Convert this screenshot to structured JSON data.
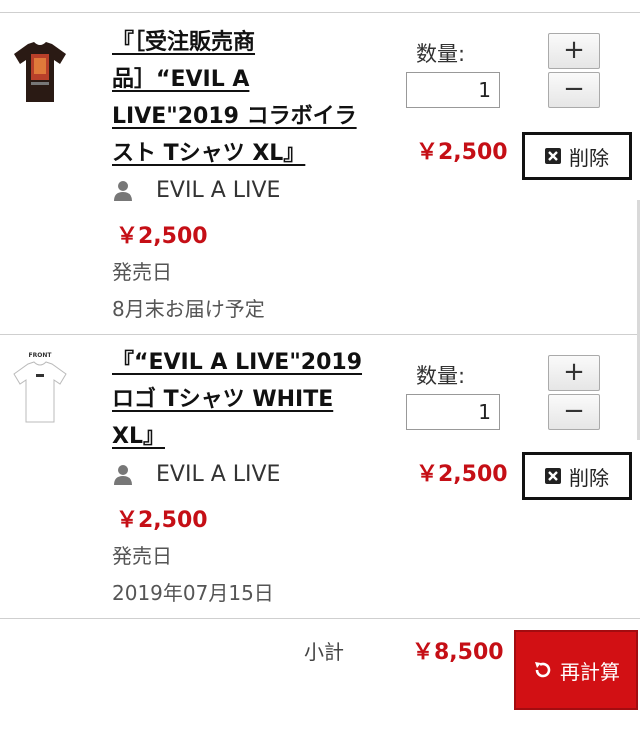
{
  "cart": {
    "items": [
      {
        "title": "『［受注販売商品］“EVIL A LIVE\"2019 コラボイラスト Tシャツ XL』",
        "artist": "EVIL A LIVE",
        "price": "￥2,500",
        "release_label": "発売日",
        "release_value": "8月末お届け予定",
        "qty_label": "数量:",
        "qty_value": "1",
        "line_total": "￥2,500",
        "plus_label": "+",
        "minus_label": "−",
        "delete_label": "削除"
      },
      {
        "title": "『“EVIL A LIVE\"2019 ロゴ Tシャツ WHITE XL』",
        "artist": "EVIL A LIVE",
        "price": "￥2,500",
        "release_label": "発売日",
        "release_value": "2019年07月15日",
        "qty_label": "数量:",
        "qty_value": "1",
        "line_total": "￥2,500",
        "plus_label": "+",
        "minus_label": "−",
        "delete_label": "削除",
        "thumb_text": "FRONT"
      }
    ],
    "subtotal_label": "小計",
    "subtotal_value": "￥8,500",
    "recalc_label": "再計算"
  },
  "icons": {
    "person": "person-icon",
    "delete": "x-box-icon",
    "recalc": "refresh-icon"
  },
  "colors": {
    "price_red": "#c50f16",
    "recalc_bg": "#d21014"
  }
}
